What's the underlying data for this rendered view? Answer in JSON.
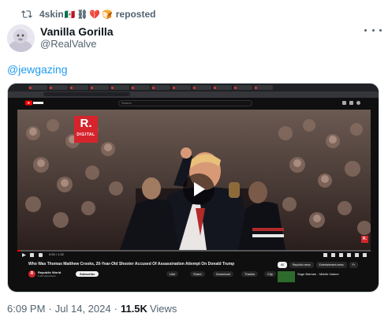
{
  "repost": {
    "user": "4skin",
    "emojis": [
      "🇲🇽",
      "⛓",
      "💔",
      "🍞"
    ],
    "label": "reposted"
  },
  "author": {
    "name": "Vanilla Gorilla",
    "handle": "@RealValve"
  },
  "post": {
    "text": "@jewgazing"
  },
  "embedded_screenshot": {
    "youtube_search_placeholder": "Search",
    "video_title": "Who Was Thomas Matthew Crooks, 20-Year-Old Shooter Accused Of Assassination Attempt On Donald Trump",
    "channel_name": "Republic World",
    "channel_subs": "5.1M subscribers",
    "subscribe_label": "Subscribe",
    "timecode": "0:00 / 1:32",
    "actions": [
      "Like",
      "Share",
      "Download",
      "Thanks",
      "Clip",
      "Save"
    ],
    "chips": [
      "All",
      "Republic news",
      "Entertainment news",
      "Fr"
    ],
    "watermark_text": "R.",
    "watermark_sub": "DIGITAL",
    "recommendation_title": "Sage Batman - Middle Nature"
  },
  "meta": {
    "time": "6:09 PM",
    "date": "Jul 14, 2024",
    "views_count": "11.5K",
    "views_label": "Views"
  },
  "colors": {
    "link": "#1d9bf0",
    "muted": "#536471",
    "youtube_red": "#ff0000",
    "republic_red": "#d6242c"
  }
}
